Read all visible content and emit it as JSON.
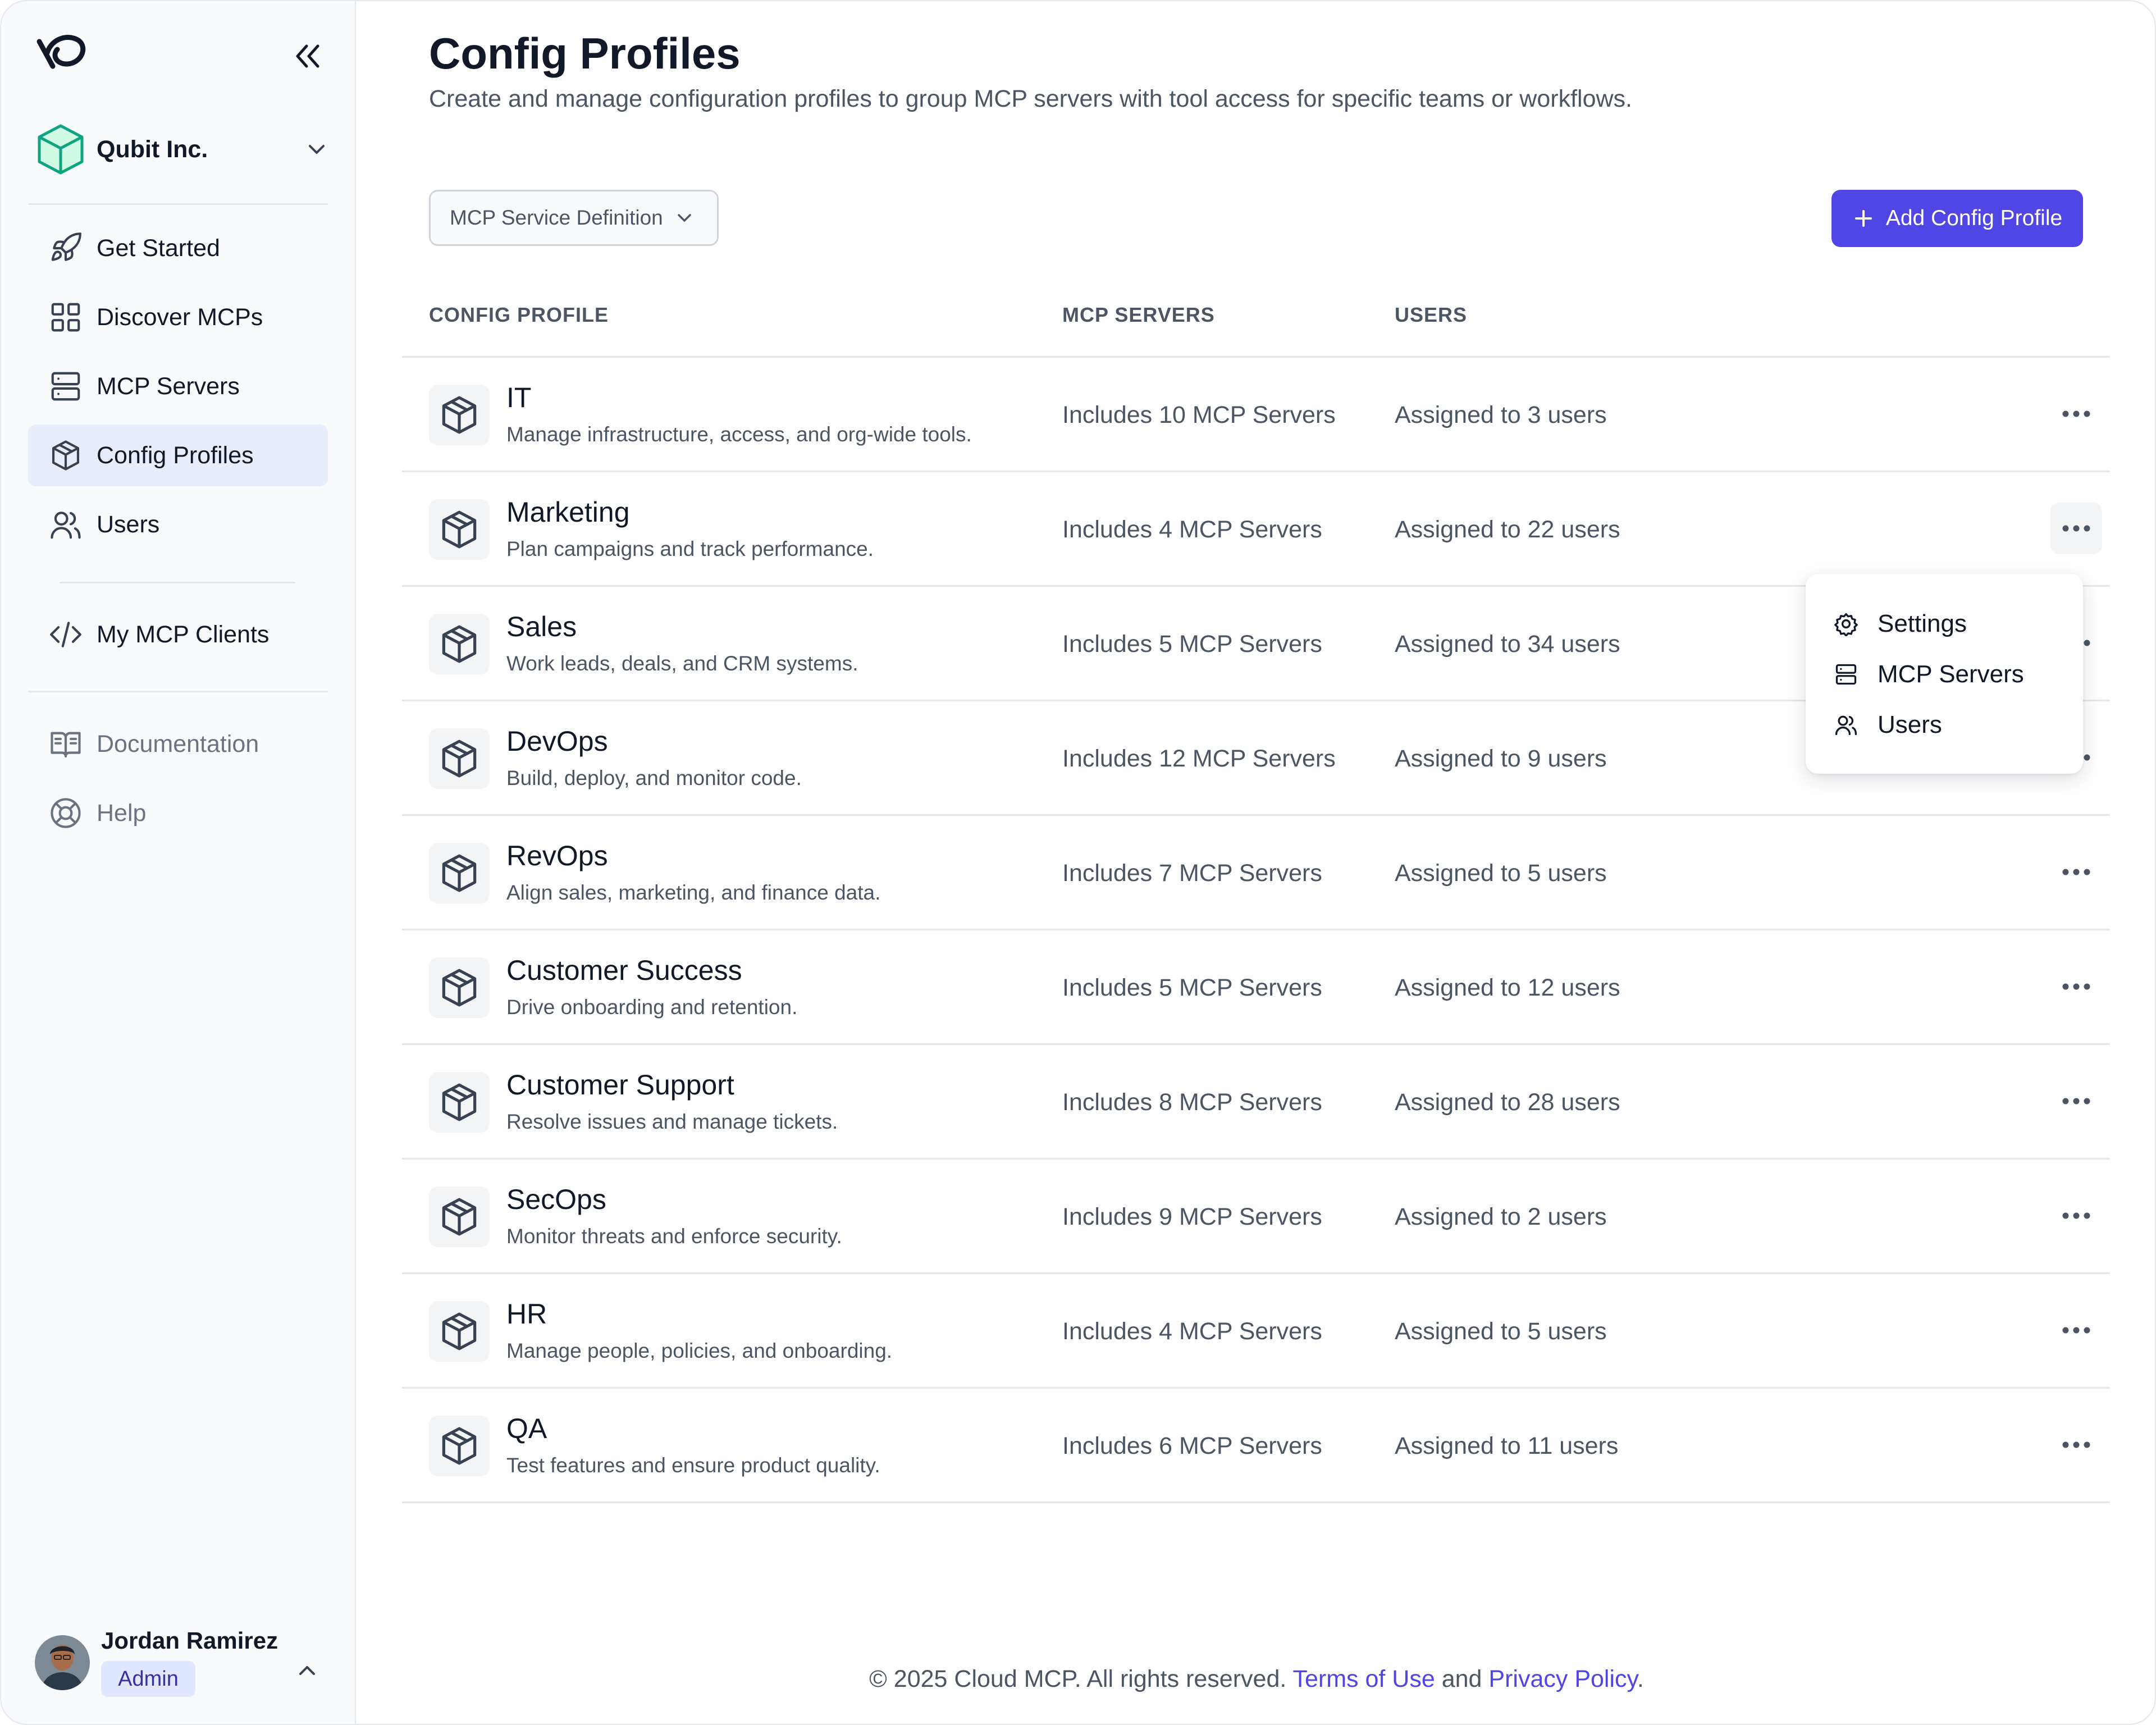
{
  "sidebar": {
    "org_name": "Qubit Inc.",
    "nav_primary": [
      {
        "label": "Get Started",
        "icon": "rocket-icon"
      },
      {
        "label": "Discover MCPs",
        "icon": "grid-icon"
      },
      {
        "label": "MCP Servers",
        "icon": "server-icon"
      },
      {
        "label": "Config Profiles",
        "icon": "package-icon",
        "active": true
      },
      {
        "label": "Users",
        "icon": "users-icon"
      }
    ],
    "nav_secondary": [
      {
        "label": "My MCP Clients",
        "icon": "code-icon"
      }
    ],
    "nav_tertiary": [
      {
        "label": "Documentation",
        "icon": "book-icon"
      },
      {
        "label": "Help",
        "icon": "lifebuoy-icon"
      }
    ],
    "user": {
      "name": "Jordan Ramirez",
      "role": "Admin"
    }
  },
  "header": {
    "title": "Config Profiles",
    "subtitle": "Create and manage configuration profiles to group MCP servers with tool access for specific teams or workflows."
  },
  "toolbar": {
    "filter_label": "MCP Service Definition",
    "add_label": "Add Config Profile"
  },
  "table": {
    "columns": [
      "CONFIG PROFILE",
      "MCP SERVERS",
      "USERS"
    ],
    "rows": [
      {
        "name": "IT",
        "description": "Manage infrastructure, access, and org-wide tools.",
        "servers": "Includes 10 MCP Servers",
        "users": "Assigned to 3 users"
      },
      {
        "name": "Marketing",
        "description": "Plan campaigns and track performance.",
        "servers": "Includes 4 MCP Servers",
        "users": "Assigned to 22 users"
      },
      {
        "name": "Sales",
        "description": "Work leads, deals, and CRM systems.",
        "servers": "Includes 5 MCP Servers",
        "users": "Assigned to 34 users"
      },
      {
        "name": "DevOps",
        "description": "Build, deploy, and monitor code.",
        "servers": "Includes 12 MCP Servers",
        "users": "Assigned to 9 users"
      },
      {
        "name": "RevOps",
        "description": "Align sales, marketing, and finance data.",
        "servers": "Includes 7 MCP Servers",
        "users": "Assigned to 5 users"
      },
      {
        "name": "Customer Success",
        "description": "Drive onboarding and retention.",
        "servers": "Includes 5 MCP Servers",
        "users": "Assigned to 12 users"
      },
      {
        "name": "Customer Support",
        "description": "Resolve issues and manage tickets.",
        "servers": "Includes 8 MCP Servers",
        "users": "Assigned to 28 users"
      },
      {
        "name": "SecOps",
        "description": "Monitor threats and enforce security.",
        "servers": "Includes 9 MCP Servers",
        "users": "Assigned to 2 users"
      },
      {
        "name": "HR",
        "description": "Manage people, policies, and onboarding.",
        "servers": "Includes 4 MCP Servers",
        "users": "Assigned to 5 users"
      },
      {
        "name": "QA",
        "description": "Test features and ensure product quality.",
        "servers": "Includes 6 MCP Servers",
        "users": "Assigned to 11 users"
      }
    ]
  },
  "row_menu": {
    "open_on_row": "Marketing",
    "items": [
      {
        "label": "Settings",
        "icon": "gear-icon"
      },
      {
        "label": "MCP Servers",
        "icon": "server-icon"
      },
      {
        "label": "Users",
        "icon": "users-icon"
      }
    ]
  },
  "footer": {
    "copyright": "© 2025 Cloud MCP. All rights reserved.",
    "terms": "Terms of Use",
    "and": "and",
    "privacy": "Privacy Policy",
    "period": "."
  },
  "colors": {
    "accent": "#4f46e5",
    "active_nav": "#e7edfb",
    "brand_green": "#10a37f"
  }
}
